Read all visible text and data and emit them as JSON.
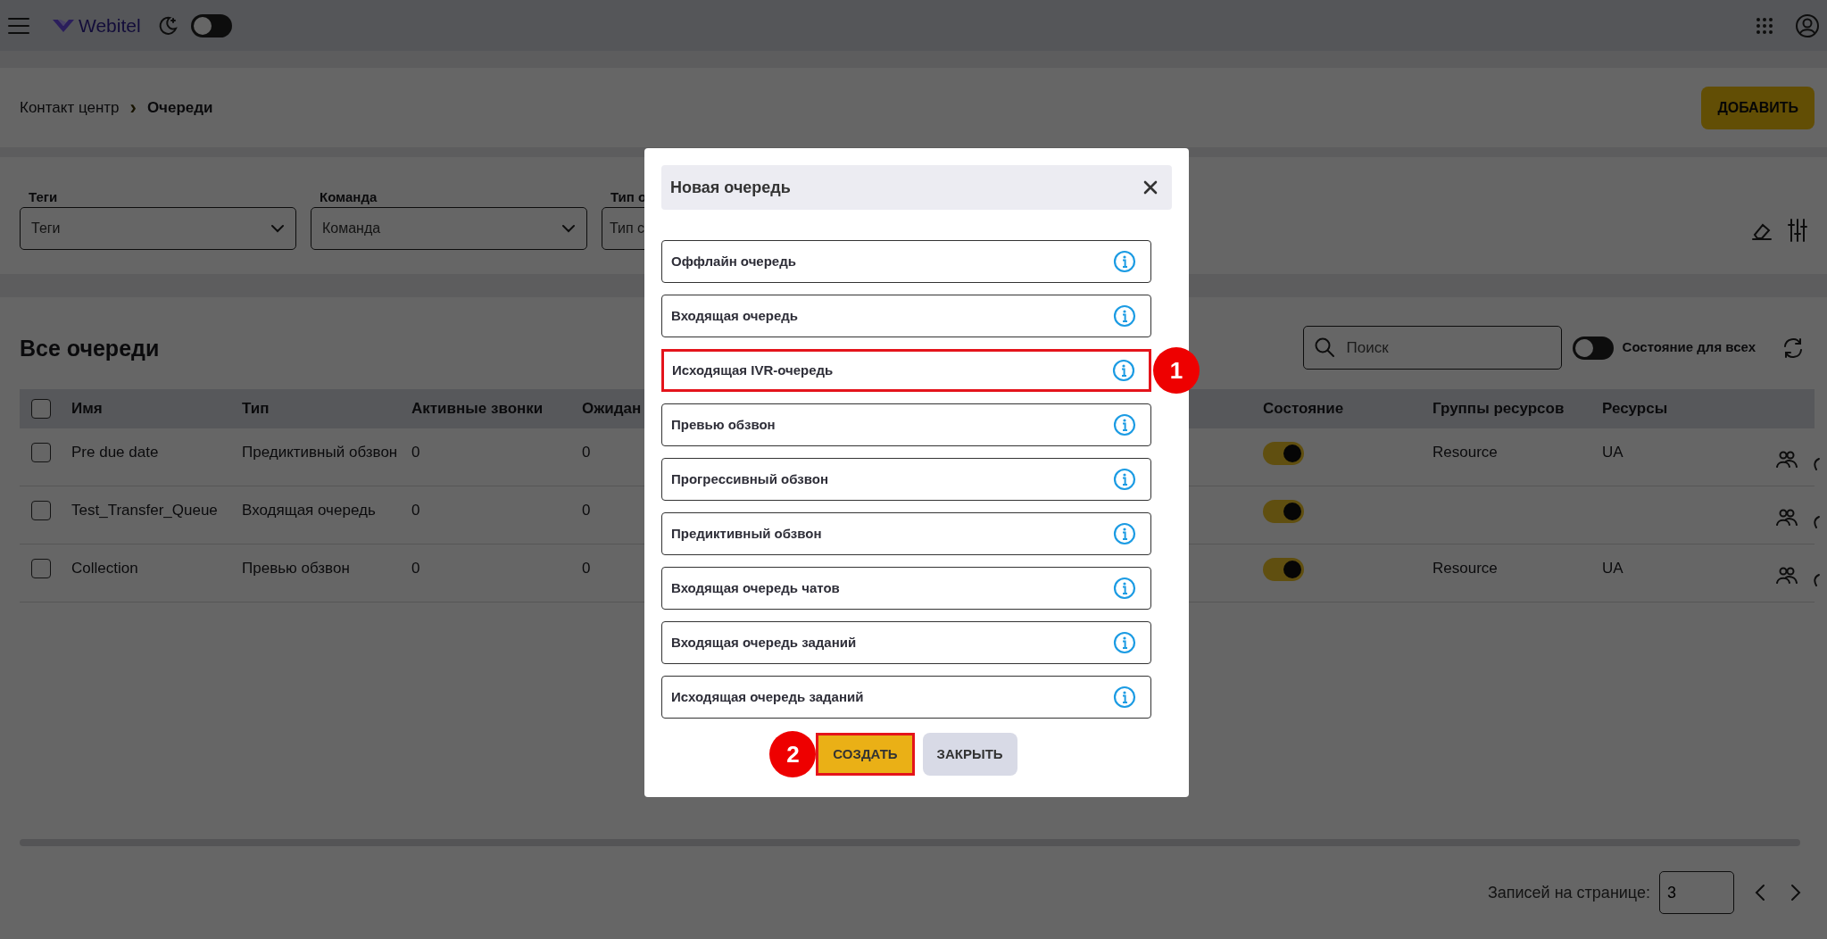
{
  "top_bar": {
    "logo": "Webitel",
    "theme_toggle": {
      "on": false
    }
  },
  "breadcrumb": {
    "items": [
      "Контакт центр",
      "Очереди"
    ],
    "separator": "›"
  },
  "add_button": "ДОБАВИТЬ",
  "filters": [
    {
      "label": "Теги",
      "placeholder": "Теги"
    },
    {
      "label": "Команда",
      "placeholder": "Команда"
    },
    {
      "label": "Тип о",
      "placeholder": "Тип с"
    }
  ],
  "table_panel": {
    "title": "Все очереди",
    "search": {
      "placeholder": "Поиск"
    },
    "state_for_all": {
      "label": "Состояние для всех",
      "on": false
    }
  },
  "table": {
    "select_all_checked": false,
    "columns_left": [
      "Имя",
      "Тип",
      "Активные звонки",
      "Ожидан"
    ],
    "columns_right": [
      "Состояние",
      "Группы ресурсов",
      "Ресурсы"
    ],
    "rows": [
      {
        "checked": false,
        "name": "Pre due date",
        "type": "Предиктивный обзвон",
        "active_calls": "0",
        "waiting": "0",
        "state_on": true,
        "resource_groups": "Resource",
        "resources": "UA"
      },
      {
        "checked": false,
        "name": "Test_Transfer_Queue",
        "type": "Входящая очередь",
        "active_calls": "0",
        "waiting": "0",
        "state_on": true
      },
      {
        "checked": false,
        "name": "Collection",
        "type": "Превью обзвон",
        "active_calls": "0",
        "waiting": "0",
        "state_on": true,
        "resource_groups": "Resource",
        "resources": "UA"
      }
    ]
  },
  "pagination": {
    "label": "Записей на странице:",
    "value": "3"
  },
  "modal": {
    "title": "Новая очередь",
    "options": [
      {
        "label": "Оффлайн очередь",
        "highlighted": false
      },
      {
        "label": "Входящая очередь",
        "highlighted": false
      },
      {
        "label": "Исходящая IVR-очередь",
        "highlighted": true,
        "marker": "1"
      },
      {
        "label": "Превью обзвон",
        "highlighted": false
      },
      {
        "label": "Прогрессивный обзвон",
        "highlighted": false
      },
      {
        "label": "Предиктивный обзвон",
        "highlighted": false
      },
      {
        "label": "Входящая очередь чатов",
        "highlighted": false
      },
      {
        "label": "Входящая очередь заданий",
        "highlighted": false
      },
      {
        "label": "Исходящая очередь заданий",
        "highlighted": false
      }
    ],
    "buttons": [
      {
        "kind": "primary",
        "label": "СОЗДАТЬ",
        "highlighted": true,
        "marker": "2"
      },
      {
        "kind": "secondary",
        "label": "ЗАКРЫТЬ",
        "highlighted": false
      }
    ]
  }
}
